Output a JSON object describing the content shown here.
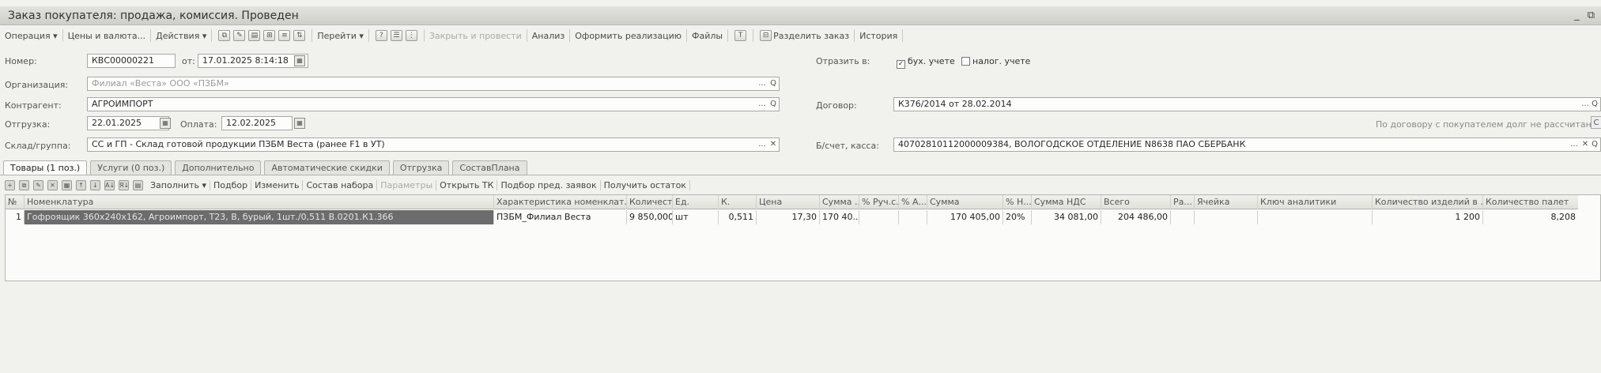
{
  "window": {
    "title": "Заказ покупателя: продажа, комиссия. Проведен",
    "controls": [
      "_",
      "⧉"
    ]
  },
  "toolbar": {
    "items": [
      {
        "label": "Операция ▾",
        "enabled": true
      },
      {
        "label": "Цены и валюта...",
        "enabled": true
      },
      {
        "label": "Действия ▾",
        "enabled": true
      },
      {
        "label": "Перейти ▾",
        "enabled": true
      },
      {
        "label": "Закрыть и провести",
        "enabled": false
      },
      {
        "label": "Анализ",
        "enabled": true
      },
      {
        "label": "Оформить реализацию",
        "enabled": true
      },
      {
        "label": "Файлы",
        "enabled": true
      },
      {
        "label": "Разделить заказ",
        "enabled": true
      },
      {
        "label": "История",
        "enabled": true
      }
    ]
  },
  "form": {
    "number_label": "Номер:",
    "number_value": "КВС00000221",
    "date_from_label": "от:",
    "date_value": "17.01.2025 8:14:18",
    "reflect_label": "Отразить в:",
    "reflect_accounting": "бух. учете",
    "reflect_accounting_checked": true,
    "reflect_tax": "налог. учете",
    "reflect_tax_checked": false,
    "organization_label": "Организация:",
    "organization_value": "Филиал «Веста» ООО «ПЗБМ»",
    "counterparty_label": "Контрагент:",
    "counterparty_value": "АГРОИМПОРТ",
    "contract_label": "Договор:",
    "contract_value": "К376/2014 от 28.02.2014",
    "shipment_label": "Отгрузка:",
    "shipment_value": "22.01.2025",
    "payment_label": "Оплата:",
    "payment_value": "12.02.2025",
    "debt_note": "По договору с покупателем долг не рассчитан",
    "warehouse_label": "Склад/группа:",
    "warehouse_value": "СС и ГП - Склад готовой продукции ПЗБМ Веста (ранее F1 в УТ)",
    "bank_label": "Б/счет, касса:",
    "bank_value": "40702810112000009384, ВОЛОГОДСКОЕ ОТДЕЛЕНИЕ N8638 ПАО СБЕРБАНК"
  },
  "tabs": [
    {
      "label": "Товары (1 поз.)",
      "active": true
    },
    {
      "label": "Услуги (0 поз.)",
      "active": false
    },
    {
      "label": "Дополнительно",
      "active": false
    },
    {
      "label": "Автоматические скидки",
      "active": false
    },
    {
      "label": "Отгрузка",
      "active": false
    },
    {
      "label": "СоставПлана",
      "active": false
    }
  ],
  "grid_toolbar": {
    "items": [
      {
        "label": "Заполнить ▾",
        "enabled": true
      },
      {
        "label": "Подбор",
        "enabled": true
      },
      {
        "label": "Изменить",
        "enabled": true
      },
      {
        "label": "Состав набора",
        "enabled": true
      },
      {
        "label": "Параметры",
        "enabled": false
      },
      {
        "label": "Открыть ТК",
        "enabled": true
      },
      {
        "label": "Подбор пред. заявок",
        "enabled": true
      },
      {
        "label": "Получить остаток",
        "enabled": true
      }
    ]
  },
  "table": {
    "columns": [
      "№",
      "Номенклатура",
      "Характеристика номенклат...",
      "Количест...",
      "Ед.",
      "К.",
      "Цена",
      "Сумма ...",
      "% Руч.с...",
      "% А...",
      "Сумма",
      "% Н...",
      "Сумма НДС",
      "Всего",
      "Ра...",
      "Ячейка",
      "Ключ аналитики",
      "Количество изделий в ...",
      "Количество палет"
    ],
    "rows": [
      [
        "1",
        "Гофроящик 360х240х162, Агроимпорт, Т23, В, бурый, 1шт./0,511 В.0201.К1.366",
        "ПЗБМ_Филиал Веста",
        "9 850,000",
        "шт",
        "0,511",
        "17,30",
        "170 40...",
        "",
        "",
        "170 405,00",
        "20%",
        "34 081,00",
        "204 486,00",
        "",
        "",
        "",
        "1 200",
        "8,208"
      ]
    ]
  }
}
